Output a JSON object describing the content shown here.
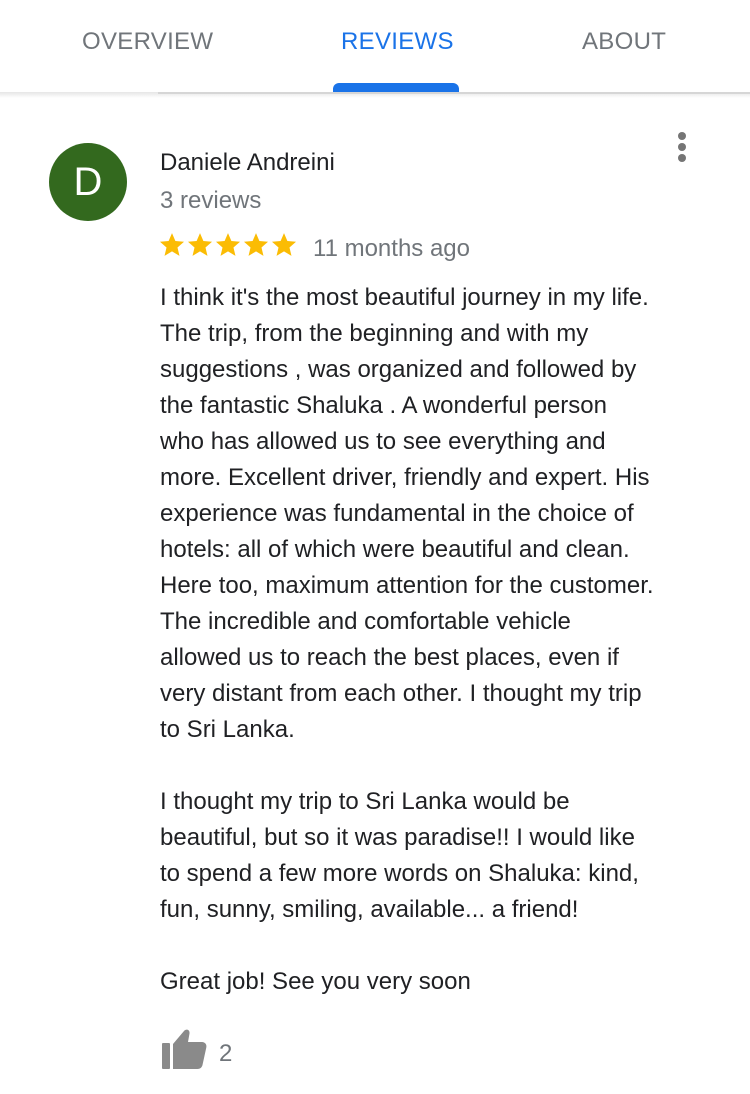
{
  "tabs": {
    "overview": "OVERVIEW",
    "reviews": "REVIEWS",
    "about": "ABOUT",
    "active": "REVIEWS",
    "accent_color": "#1a73e8"
  },
  "review": {
    "avatar_letter": "D",
    "avatar_color": "#33691e",
    "author": "Daniele Andreini",
    "review_count": "3 reviews",
    "rating": 5,
    "star_color": "#fbbc04",
    "time_ago": "11 months ago",
    "paragraphs": [
      "I think it's the most beautiful journey in my life.\nThe trip, from the beginning and with my\nsuggestions , was organized and followed by\nthe fantastic Shaluka . A wonderful person\nwho has allowed us to see everything and\nmore. Excellent driver, friendly and expert. His\nexperience was fundamental in the choice of\nhotels: all of which were beautiful and clean.\nHere too, maximum attention for the customer.\nThe incredible and comfortable vehicle\nallowed us to reach the best places, even if\nvery distant from each other. I thought my trip\nto Sri Lanka.",
      "I thought my trip to Sri Lanka would be\nbeautiful, but so it was paradise!! I would like\nto spend a few more words on Shaluka: kind,\nfun, sunny, smiling, available... a friend!",
      "Great job! See you very soon"
    ],
    "like_count": "2",
    "icons": {
      "more": "more-vertical-icon",
      "like": "thumbs-up-icon",
      "star": "star-icon"
    }
  }
}
